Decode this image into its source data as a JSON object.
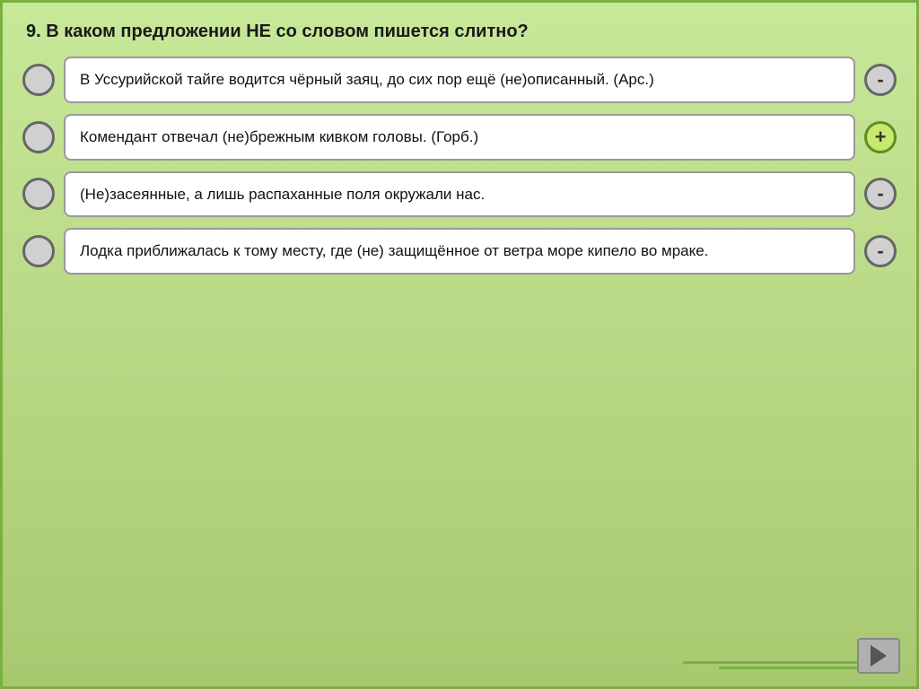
{
  "question": {
    "number": "9.",
    "text": "9.  В  каком  предложении  НЕ  со  словом  пишется слитно?"
  },
  "answers": [
    {
      "id": 1,
      "text": "В Уссурийской тайге водится чёрный заяц, до сих пор ещё (не)описанный. (Арс.)",
      "sign": "-",
      "sign_type": "minus"
    },
    {
      "id": 2,
      "text": "Комендант отвечал (не)брежным кивком головы. (Горб.)",
      "sign": "+",
      "sign_type": "plus"
    },
    {
      "id": 3,
      "text": "(Не)засеянные,  а  лишь  распаханные  поля окружали нас.",
      "sign": "-",
      "sign_type": "minus"
    },
    {
      "id": 4,
      "text": "Лодка  приближалась  к  тому  месту,  где  (не) защищённое от ветра море кипело во мраке.",
      "sign": "-",
      "sign_type": "minus"
    }
  ],
  "nav": {
    "next_label": "▶"
  }
}
